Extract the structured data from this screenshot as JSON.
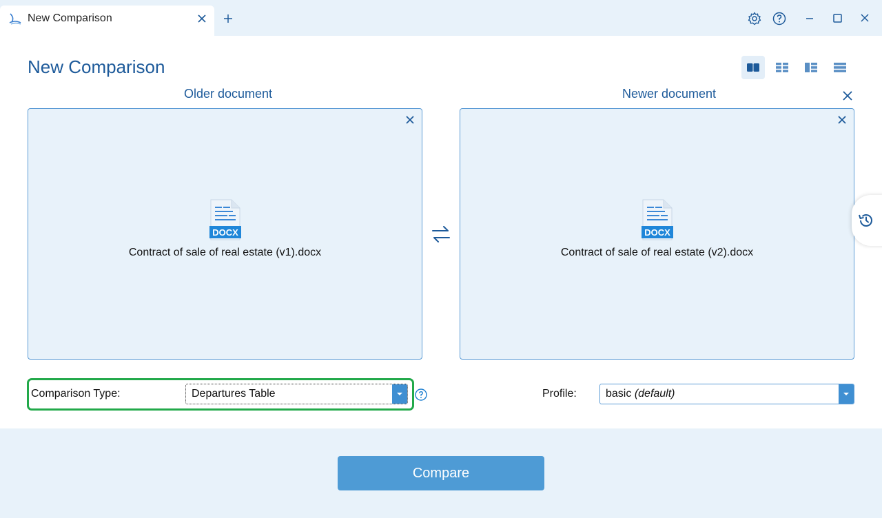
{
  "tab": {
    "title": "New Comparison"
  },
  "page": {
    "title": "New Comparison"
  },
  "documents": {
    "older": {
      "label": "Older document",
      "file_name": "Contract of sale of real estate (v1).docx",
      "file_type": "DOCX"
    },
    "newer": {
      "label": "Newer document",
      "file_name": "Contract of sale of real estate (v2).docx",
      "file_type": "DOCX"
    }
  },
  "options": {
    "comparison_type": {
      "label": "Comparison Type:",
      "value": "Departures Table"
    },
    "profile": {
      "label": "Profile:",
      "value": "basic",
      "value_note": "(default)"
    }
  },
  "actions": {
    "compare_label": "Compare"
  },
  "colors": {
    "accent": "#1d5a9a",
    "button": "#4e9bd5",
    "highlight": "#22a94a",
    "panel": "#e8f2fa"
  },
  "icons": [
    "app-logo-icon",
    "close-icon",
    "plus-icon",
    "settings-icon",
    "help-icon",
    "minimize-icon",
    "maximize-icon",
    "side-by-side-view-icon",
    "grid-view-icon",
    "split-view-icon",
    "list-view-icon",
    "swap-icon",
    "history-icon",
    "docx-file-icon",
    "chevron-down-icon"
  ]
}
